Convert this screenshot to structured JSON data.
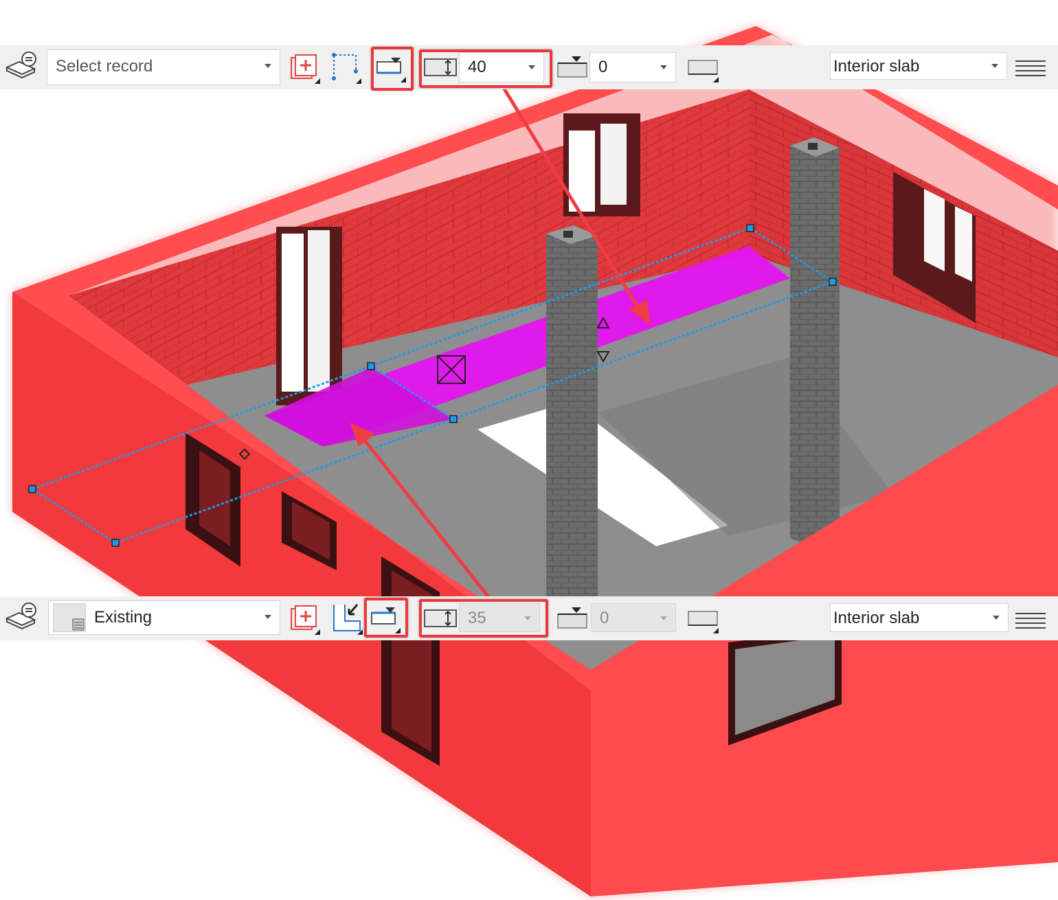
{
  "colors": {
    "wall_red": "#f2393c",
    "slab_magenta": "#e414f0",
    "floor_gray": "#8c8c8c",
    "column_gray": "#6a6a6a",
    "selection_blue": "#1e9be6",
    "highlight_red": "#e8383d",
    "toolbar_bg": "#f0f0f0"
  },
  "top_toolbar": {
    "record_select": {
      "value": "Select record",
      "placeholder": "Select record"
    },
    "icons": [
      "slab-properties-icon",
      "add-element-icon",
      "polygon-input-icon",
      "reference-position-icon"
    ],
    "thickness": {
      "value": "40"
    },
    "offset": {
      "value": "0"
    },
    "material": {
      "value": "Interior slab"
    }
  },
  "bottom_toolbar": {
    "record_select": {
      "value": "Existing"
    },
    "icons": [
      "slab-properties-icon",
      "record-preview-icon",
      "add-element-icon",
      "pick-element-icon",
      "reference-position-icon"
    ],
    "thickness": {
      "value": "35",
      "state": "disabled"
    },
    "offset": {
      "value": "0",
      "state": "disabled"
    },
    "material": {
      "value": "Interior slab"
    }
  }
}
